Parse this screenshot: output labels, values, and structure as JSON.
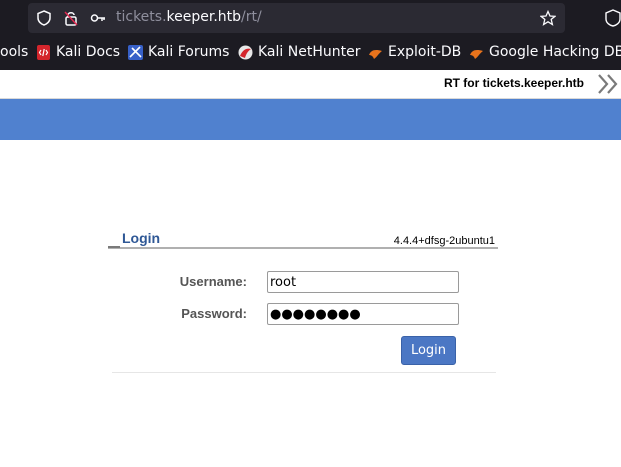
{
  "browser": {
    "url_prefix": "tickets.",
    "url_host": "keeper.htb",
    "url_path": "/rt/",
    "icons": [
      "shield-icon",
      "lock-broken-icon",
      "key-icon",
      "star-icon",
      "extension-icon"
    ]
  },
  "bookmarks": [
    {
      "label": "ools",
      "icon": ""
    },
    {
      "label": "Kali Docs",
      "icon": "kali-docs-icon"
    },
    {
      "label": "Kali Forums",
      "icon": "kali-forums-icon"
    },
    {
      "label": "Kali NetHunter",
      "icon": "kali-nethunter-icon"
    },
    {
      "label": "Exploit-DB",
      "icon": "exploit-db-icon"
    },
    {
      "label": "Google Hacking DB",
      "icon": "google-hacking-db-icon"
    }
  ],
  "header": {
    "title": "RT for tickets.keeper.htb",
    "accent": "#5081cf"
  },
  "login": {
    "title": "Login",
    "version": "4.4.4+dfsg-2ubuntu1",
    "username_label": "Username:",
    "username_value": "root",
    "password_label": "Password:",
    "password_value": "●●●●●●●●",
    "button_label": "Login"
  }
}
